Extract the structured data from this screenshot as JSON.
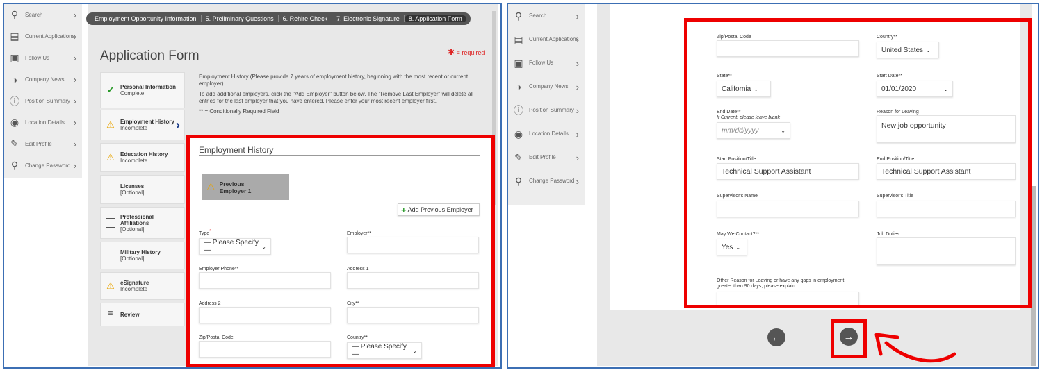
{
  "sidebar": {
    "items": [
      {
        "label": "Search",
        "icon": "search-icon"
      },
      {
        "label": "Current Applications",
        "icon": "clipboard-icon"
      },
      {
        "label": "Follow Us",
        "icon": "chat-icon"
      },
      {
        "label": "Company News",
        "icon": "globe-icon"
      },
      {
        "label": "Position Summary",
        "icon": "info-icon"
      },
      {
        "label": "Location Details",
        "icon": "pin-icon"
      },
      {
        "label": "Edit Profile",
        "icon": "edit-icon"
      },
      {
        "label": "Change Password",
        "icon": "key-icon"
      }
    ]
  },
  "breadcrumbs": [
    "Employment Opportunity Information",
    "5. Preliminary Questions",
    "6. Rehire Check",
    "7. Electronic Signature",
    "8. Application Form"
  ],
  "page_title": "Application Form",
  "required_note": "= required",
  "steps": [
    {
      "title": "Personal Information",
      "status": "Complete",
      "icon": "check-icon"
    },
    {
      "title": "Employment History",
      "status": "Incomplete",
      "icon": "warning-icon"
    },
    {
      "title": "Education History",
      "status": "Incomplete",
      "icon": "warning-icon"
    },
    {
      "title": "Licenses",
      "status": "[Optional]",
      "icon": "checkbox-icon"
    },
    {
      "title": "Professional Affiliations",
      "status": "[Optional]",
      "icon": "checkbox-icon"
    },
    {
      "title": "Military History",
      "status": "[Optional]",
      "icon": "checkbox-icon"
    },
    {
      "title": "eSignature",
      "status": "Incomplete",
      "icon": "warning-icon"
    },
    {
      "title": "Review",
      "status": "",
      "icon": "review-icon"
    }
  ],
  "intro": {
    "p1": "Employment History (Please provide 7 years of employment history, beginning with the most recent or current employer)",
    "p2": "To add additional employers, click the \"Add Employer\" button below. The \"Remove Last Employer\" will delete all entries for the last employer that you have entered. Please enter your most recent employer first.",
    "p3": "** = Conditionally Required Field"
  },
  "left_form": {
    "section_title": "Employment History",
    "employer_tab": "Previous Employer 1",
    "add_button": "Add Previous Employer",
    "type_label": "Type",
    "type_value": "— Please Specify —",
    "employer_label": "Employer**",
    "employer_phone_label": "Employer Phone**",
    "address1_label": "Address 1",
    "address2_label": "Address 2",
    "city_label": "City**",
    "zip_label": "Zip/Postal Code",
    "country_label": "Country**",
    "country_value": "— Please Specify —"
  },
  "right_form": {
    "zip_label": "Zip/Postal Code",
    "country_label": "Country**",
    "country_value": "United States",
    "state_label": "State**",
    "state_value": "California",
    "start_date_label": "Start Date**",
    "start_date_value": "01/01/2020",
    "end_date_label": "End Date**",
    "end_date_hint": "If Current, please leave blank",
    "end_date_placeholder": "mm/dd/yyyy",
    "reason_label": "Reason for Leaving",
    "reason_value": "New job opportunity",
    "start_position_label": "Start Position/Title",
    "start_position_value": "Technical Support Assistant",
    "end_position_label": "End Position/Title",
    "end_position_value": "Technical Support Assistant",
    "supervisor_name_label": "Supervisor's Name",
    "supervisor_title_label": "Supervisor's Title",
    "contact_label": "May We Contact?**",
    "contact_value": "Yes",
    "job_duties_label": "Job Duties",
    "other_reason_label": "Other Reason for Leaving or have any gaps in employment greater than 90 days, please explain"
  },
  "colors": {
    "highlight": "#e00000",
    "frame": "#3c6fb4"
  }
}
